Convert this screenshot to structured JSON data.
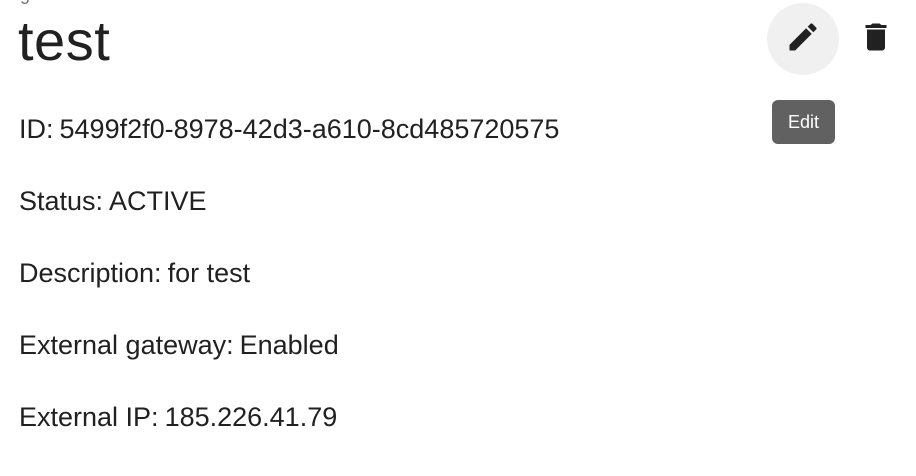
{
  "page": {
    "clipped_heading": "g",
    "title": "test"
  },
  "fields": {
    "id": {
      "label": "ID:",
      "value": "5499f2f0-8978-42d3-a610-8cd485720575"
    },
    "status": {
      "label": "Status:",
      "value": "ACTIVE"
    },
    "description": {
      "label": "Description:",
      "value": "for test"
    },
    "external_gateway": {
      "label": "External gateway:",
      "value": "Enabled"
    },
    "external_ip": {
      "label": "External IP:",
      "value": "185.226.41.79"
    }
  },
  "actions": {
    "edit_icon": "pencil-icon",
    "delete_icon": "trash-icon",
    "edit_tooltip": "Edit"
  },
  "colors": {
    "text": "#212121",
    "edit_button_bg": "#f0f0f0",
    "tooltip_bg": "#616161",
    "tooltip_text": "#ffffff"
  }
}
